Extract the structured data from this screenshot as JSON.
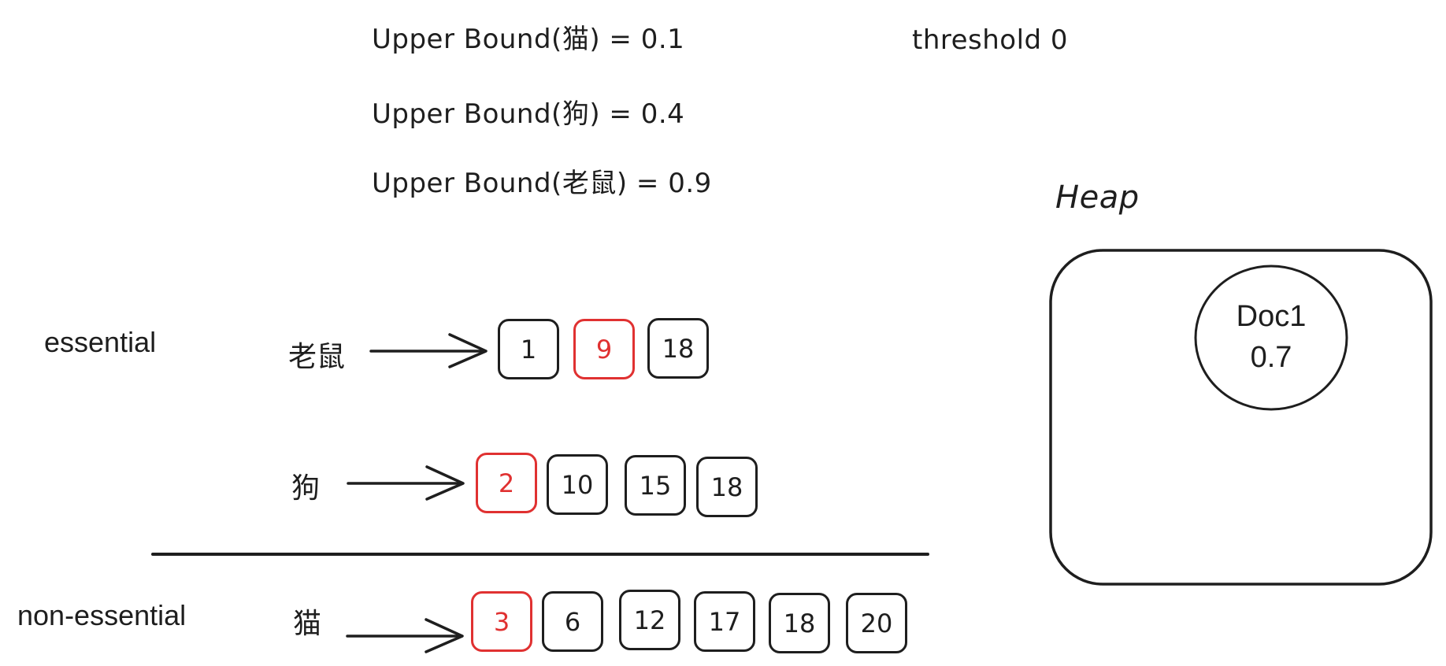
{
  "upper_bounds": [
    {
      "term": "猫",
      "text": "Upper Bound(猫) = 0.1",
      "value": 0.1
    },
    {
      "term": "狗",
      "text": "Upper Bound(狗) = 0.4",
      "value": 0.4
    },
    {
      "term": "老鼠",
      "text": "Upper Bound(老鼠) = 0.9",
      "value": 0.9
    }
  ],
  "threshold": {
    "text": "threshold 0",
    "value": 0
  },
  "groups": {
    "essential_label": "essential",
    "non_essential_label": "non-essential"
  },
  "posting_lists": [
    {
      "term": "老鼠",
      "group": "essential",
      "docs": [
        {
          "id": "1",
          "highlight": false
        },
        {
          "id": "9",
          "highlight": true
        },
        {
          "id": "18",
          "highlight": false
        }
      ]
    },
    {
      "term": "狗",
      "group": "essential",
      "docs": [
        {
          "id": "2",
          "highlight": true
        },
        {
          "id": "10",
          "highlight": false
        },
        {
          "id": "15",
          "highlight": false
        },
        {
          "id": "18",
          "highlight": false
        }
      ]
    },
    {
      "term": "猫",
      "group": "non-essential",
      "docs": [
        {
          "id": "3",
          "highlight": true
        },
        {
          "id": "6",
          "highlight": false
        },
        {
          "id": "12",
          "highlight": false
        },
        {
          "id": "17",
          "highlight": false
        },
        {
          "id": "18",
          "highlight": false
        },
        {
          "id": "20",
          "highlight": false
        }
      ]
    }
  ],
  "heap": {
    "title": "Heap",
    "items": [
      {
        "doc": "Doc1",
        "score": "0.7"
      }
    ]
  },
  "colors": {
    "stroke": "#1e1e1e",
    "highlight": "#e03131",
    "background": "#ffffff"
  }
}
